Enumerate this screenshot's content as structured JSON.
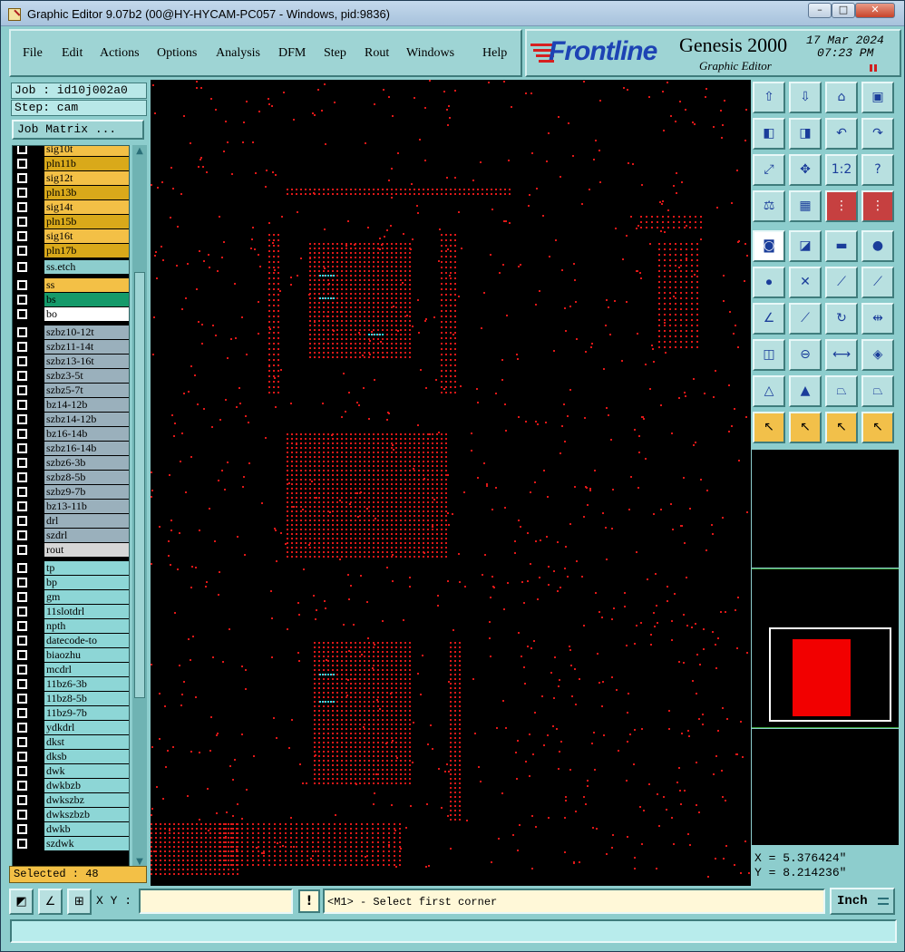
{
  "window": {
    "title": "Graphic Editor 9.07b2 (00@HY-HYCAM-PC057 - Windows, pid:9836)"
  },
  "menu": [
    {
      "label": "File",
      "icon": null
    },
    {
      "label": "Edit",
      "icon": null
    },
    {
      "label": "Actions",
      "icon": null
    },
    {
      "label": "Options",
      "icon": null
    },
    {
      "label": "Analysis",
      "icon": null
    },
    {
      "label": "DFM",
      "icon": null
    },
    {
      "label": "Step",
      "icon": null
    },
    {
      "label": "Rout",
      "icon": null
    },
    {
      "label": "Windows",
      "icon": null
    },
    {
      "label": "Help",
      "icon": null
    }
  ],
  "logo": {
    "brand": "Frontline",
    "product": "Genesis 2000",
    "subtitle": "Graphic Editor",
    "date": "17 Mar 2024",
    "time": "07:23 PM"
  },
  "left": {
    "job": "Job : id10j002a0",
    "step": "Step: cam",
    "matrix_button": "Job Matrix ..."
  },
  "layers": [
    {
      "name": "sig10t",
      "color": "#f3c046",
      "group": 0
    },
    {
      "name": "pln11b",
      "color": "#d9a91a",
      "group": 0
    },
    {
      "name": "sig12t",
      "color": "#f3c046",
      "group": 0
    },
    {
      "name": "pln13b",
      "color": "#d9a91a",
      "group": 0
    },
    {
      "name": "sig14t",
      "color": "#f3c046",
      "group": 0
    },
    {
      "name": "pln15b",
      "color": "#d9a91a",
      "group": 0
    },
    {
      "name": "sig16t",
      "color": "#f3c046",
      "group": 0
    },
    {
      "name": "pln17b",
      "color": "#d9a91a",
      "group": 0
    },
    {
      "name": "ss.etch",
      "color": "#8dcdcd",
      "group": 1
    },
    {
      "name": "ss",
      "color": "#f3c046",
      "group": 2
    },
    {
      "name": "bs",
      "color": "#159a6a",
      "group": 2
    },
    {
      "name": "bo",
      "color": "#ffffff",
      "group": 2
    },
    {
      "name": "szbz10-12t",
      "color": "#9ab0bc",
      "group": 3
    },
    {
      "name": "szbz11-14t",
      "color": "#9ab0bc",
      "group": 3
    },
    {
      "name": "szbz13-16t",
      "color": "#9ab0bc",
      "group": 3
    },
    {
      "name": "szbz3-5t",
      "color": "#9ab0bc",
      "group": 3
    },
    {
      "name": "szbz5-7t",
      "color": "#9ab0bc",
      "group": 3
    },
    {
      "name": "bz14-12b",
      "color": "#9ab0bc",
      "group": 3
    },
    {
      "name": "szbz14-12b",
      "color": "#9ab0bc",
      "group": 3
    },
    {
      "name": "bz16-14b",
      "color": "#9ab0bc",
      "group": 3
    },
    {
      "name": "szbz16-14b",
      "color": "#9ab0bc",
      "group": 3
    },
    {
      "name": "szbz6-3b",
      "color": "#9ab0bc",
      "group": 3
    },
    {
      "name": "szbz8-5b",
      "color": "#9ab0bc",
      "group": 3
    },
    {
      "name": "szbz9-7b",
      "color": "#9ab0bc",
      "group": 3
    },
    {
      "name": "bz13-11b",
      "color": "#9ab0bc",
      "group": 3
    },
    {
      "name": "drl",
      "color": "#9ab0bc",
      "group": 3
    },
    {
      "name": "szdrl",
      "color": "#9ab0bc",
      "group": 3
    },
    {
      "name": "rout",
      "color": "#d6d6d6",
      "group": 3
    },
    {
      "name": "tp",
      "color": "#8dd6d6",
      "group": 4
    },
    {
      "name": "bp",
      "color": "#8dd6d6",
      "group": 4
    },
    {
      "name": "gm",
      "color": "#8dd6d6",
      "group": 4
    },
    {
      "name": "11slotdrl",
      "color": "#8dd6d6",
      "group": 4
    },
    {
      "name": "npth",
      "color": "#8dd6d6",
      "group": 4
    },
    {
      "name": "datecode-to",
      "color": "#8dd6d6",
      "group": 4
    },
    {
      "name": "biaozhu",
      "color": "#8dd6d6",
      "group": 4
    },
    {
      "name": "mcdrl",
      "color": "#8dd6d6",
      "group": 4
    },
    {
      "name": "11bz6-3b",
      "color": "#8dd6d6",
      "group": 4
    },
    {
      "name": "11bz8-5b",
      "color": "#8dd6d6",
      "group": 4
    },
    {
      "name": "11bz9-7b",
      "color": "#8dd6d6",
      "group": 4
    },
    {
      "name": "ydkdrl",
      "color": "#8dd6d6",
      "group": 4
    },
    {
      "name": "dkst",
      "color": "#8dd6d6",
      "group": 4
    },
    {
      "name": "dksb",
      "color": "#8dd6d6",
      "group": 4
    },
    {
      "name": "dwk",
      "color": "#8dd6d6",
      "group": 4
    },
    {
      "name": "dwkbzb",
      "color": "#8dd6d6",
      "group": 4
    },
    {
      "name": "dwkszbz",
      "color": "#8dd6d6",
      "group": 4
    },
    {
      "name": "dwkszbzb",
      "color": "#8dd6d6",
      "group": 4
    },
    {
      "name": "dwkb",
      "color": "#8dd6d6",
      "group": 4
    },
    {
      "name": "szdwk",
      "color": "#8dd6d6",
      "group": 4
    }
  ],
  "selected": "Selected : 48",
  "toolbox": [
    {
      "name": "move-up-layer-icon",
      "glyph": "⇧",
      "style": ""
    },
    {
      "name": "move-down-layer-icon",
      "glyph": "⇩",
      "style": ""
    },
    {
      "name": "home-icon",
      "glyph": "⌂",
      "style": ""
    },
    {
      "name": "window-layout-icon",
      "glyph": "▣",
      "style": ""
    },
    {
      "name": "pan-left-icon",
      "glyph": "◧",
      "style": ""
    },
    {
      "name": "pan-right-icon",
      "glyph": "◨",
      "style": ""
    },
    {
      "name": "undo-view-icon",
      "glyph": "↶",
      "style": ""
    },
    {
      "name": "redo-view-icon",
      "glyph": "↷",
      "style": ""
    },
    {
      "name": "zoom-fit-icon",
      "glyph": "⤢",
      "style": ""
    },
    {
      "name": "zoom-center-icon",
      "glyph": "✥",
      "style": ""
    },
    {
      "name": "scale-1-2-icon",
      "glyph": "1:2",
      "style": ""
    },
    {
      "name": "help-icon",
      "glyph": "?",
      "style": ""
    },
    {
      "name": "measure-icon",
      "glyph": "⚖",
      "style": ""
    },
    {
      "name": "grid-icon",
      "glyph": "▦",
      "style": ""
    },
    {
      "name": "traffic-light-red-icon",
      "glyph": "⋮",
      "style": "red"
    },
    {
      "name": "traffic-light-icon",
      "glyph": "⋮",
      "style": "red"
    },
    {
      "name": "feature-info-icon",
      "glyph": "◙",
      "style": "active"
    },
    {
      "name": "select-area-icon",
      "glyph": "◪",
      "style": ""
    },
    {
      "name": "ruler-icon",
      "glyph": "▬",
      "style": ""
    },
    {
      "name": "pad-icon",
      "glyph": "●",
      "style": ""
    },
    {
      "name": "connect-icon",
      "glyph": "⦁",
      "style": ""
    },
    {
      "name": "cross-icon",
      "glyph": "✕",
      "style": ""
    },
    {
      "name": "snap-point-icon",
      "glyph": "⟋",
      "style": ""
    },
    {
      "name": "snap-line-icon",
      "glyph": "⟋",
      "style": ""
    },
    {
      "name": "angle-line-icon",
      "glyph": "∠",
      "style": ""
    },
    {
      "name": "slope-line-icon",
      "glyph": "⟋",
      "style": ""
    },
    {
      "name": "arc-icon",
      "glyph": "↻",
      "style": ""
    },
    {
      "name": "mirror-icon",
      "glyph": "⇹",
      "style": ""
    },
    {
      "name": "node-icon",
      "glyph": "◫",
      "style": ""
    },
    {
      "name": "segment-icon",
      "glyph": "⊖",
      "style": ""
    },
    {
      "name": "fit-width-icon",
      "glyph": "⟷",
      "style": ""
    },
    {
      "name": "shapes-icon",
      "glyph": "◈",
      "style": ""
    },
    {
      "name": "triangle-icon",
      "glyph": "△",
      "style": ""
    },
    {
      "name": "triangle-vertex-icon",
      "glyph": "▲",
      "style": ""
    },
    {
      "name": "trapezoid-icon",
      "glyph": "⏢",
      "style": ""
    },
    {
      "name": "trapezoid-cross-icon",
      "glyph": "⏢",
      "style": ""
    },
    {
      "name": "pointer-icon",
      "glyph": "↖",
      "style": "yel"
    },
    {
      "name": "pointer-box-icon",
      "glyph": "↖",
      "style": "yel"
    },
    {
      "name": "pointer-rotate-icon",
      "glyph": "↖",
      "style": "yel"
    },
    {
      "name": "pointer-net-icon",
      "glyph": "↖",
      "style": "yel"
    }
  ],
  "coords": {
    "x": "X = 5.376424\"",
    "y": "Y = 8.214236\""
  },
  "status": {
    "xy_label": "X Y :",
    "xy_value": "",
    "prompt": "<M1> - Select first corner",
    "units": "Inch",
    "command": ""
  }
}
